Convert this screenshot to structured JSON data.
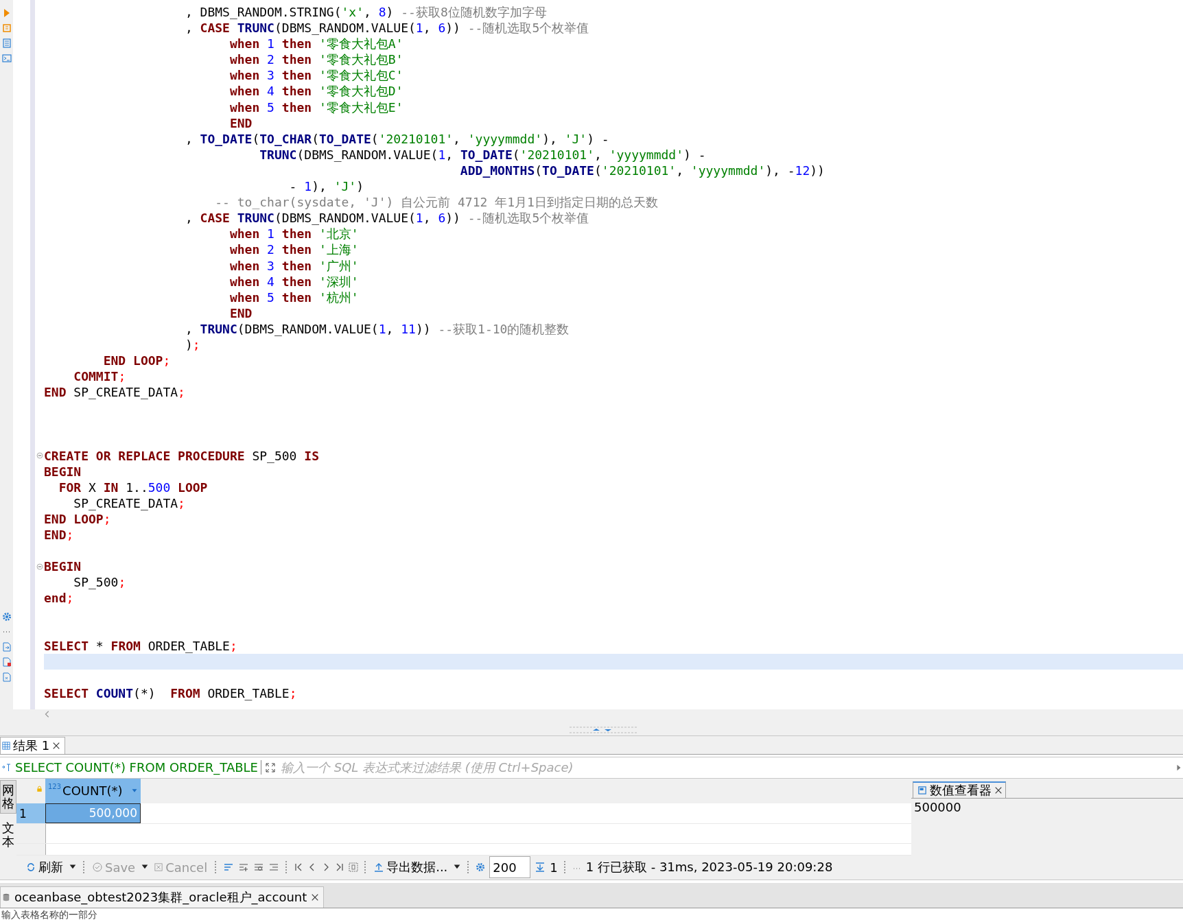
{
  "editor": {
    "lines": [
      {
        "tokens": [
          {
            "kind": "plain",
            "text": "                   , DBMS_RANDOM.STRING("
          },
          {
            "kind": "string",
            "text": "'x'"
          },
          {
            "kind": "plain",
            "text": ", "
          },
          {
            "kind": "number",
            "text": "8"
          },
          {
            "kind": "plain",
            "text": ") "
          },
          {
            "kind": "comment",
            "text": "--获取8位随机数字加字母"
          }
        ],
        "current": false,
        "fold": false
      },
      {
        "tokens": [
          {
            "kind": "plain",
            "text": "                   , "
          },
          {
            "kind": "keyword",
            "text": "CASE "
          },
          {
            "kind": "function",
            "text": "TRUNC"
          },
          {
            "kind": "plain",
            "text": "(DBMS_RANDOM.VALUE("
          },
          {
            "kind": "number",
            "text": "1"
          },
          {
            "kind": "plain",
            "text": ", "
          },
          {
            "kind": "number",
            "text": "6"
          },
          {
            "kind": "plain",
            "text": "))"
          },
          {
            "kind": "comment",
            "text": " --随机选取5个枚举值"
          }
        ],
        "current": false,
        "fold": false
      },
      {
        "tokens": [
          {
            "kind": "keyword",
            "text": "                         when "
          },
          {
            "kind": "number",
            "text": "1 "
          },
          {
            "kind": "keyword",
            "text": "then "
          },
          {
            "kind": "string",
            "text": "'零食大礼包A'"
          }
        ],
        "current": false,
        "fold": false
      },
      {
        "tokens": [
          {
            "kind": "keyword",
            "text": "                         when "
          },
          {
            "kind": "number",
            "text": "2 "
          },
          {
            "kind": "keyword",
            "text": "then "
          },
          {
            "kind": "string",
            "text": "'零食大礼包B'"
          }
        ],
        "current": false,
        "fold": false
      },
      {
        "tokens": [
          {
            "kind": "keyword",
            "text": "                         when "
          },
          {
            "kind": "number",
            "text": "3 "
          },
          {
            "kind": "keyword",
            "text": "then "
          },
          {
            "kind": "string",
            "text": "'零食大礼包C'"
          }
        ],
        "current": false,
        "fold": false
      },
      {
        "tokens": [
          {
            "kind": "keyword",
            "text": "                         when "
          },
          {
            "kind": "number",
            "text": "4 "
          },
          {
            "kind": "keyword",
            "text": "then "
          },
          {
            "kind": "string",
            "text": "'零食大礼包D'"
          }
        ],
        "current": false,
        "fold": false
      },
      {
        "tokens": [
          {
            "kind": "keyword",
            "text": "                         when "
          },
          {
            "kind": "number",
            "text": "5 "
          },
          {
            "kind": "keyword",
            "text": "then "
          },
          {
            "kind": "string",
            "text": "'零食大礼包E'"
          }
        ],
        "current": false,
        "fold": false
      },
      {
        "tokens": [
          {
            "kind": "keyword",
            "text": "                         END"
          }
        ],
        "current": false,
        "fold": false
      },
      {
        "tokens": [
          {
            "kind": "plain",
            "text": "                   , "
          },
          {
            "kind": "function",
            "text": "TO_DATE"
          },
          {
            "kind": "plain",
            "text": "("
          },
          {
            "kind": "function",
            "text": "TO_CHAR"
          },
          {
            "kind": "plain",
            "text": "("
          },
          {
            "kind": "function",
            "text": "TO_DATE"
          },
          {
            "kind": "plain",
            "text": "("
          },
          {
            "kind": "string",
            "text": "'20210101'"
          },
          {
            "kind": "plain",
            "text": ", "
          },
          {
            "kind": "string",
            "text": "'yyyymmdd'"
          },
          {
            "kind": "plain",
            "text": "), "
          },
          {
            "kind": "string",
            "text": "'J'"
          },
          {
            "kind": "plain",
            "text": ") -"
          }
        ],
        "current": false,
        "fold": false
      },
      {
        "tokens": [
          {
            "kind": "function",
            "text": "                             TRUNC"
          },
          {
            "kind": "plain",
            "text": "(DBMS_RANDOM.VALUE("
          },
          {
            "kind": "number",
            "text": "1"
          },
          {
            "kind": "plain",
            "text": ", "
          },
          {
            "kind": "function",
            "text": "TO_DATE"
          },
          {
            "kind": "plain",
            "text": "("
          },
          {
            "kind": "string",
            "text": "'20210101'"
          },
          {
            "kind": "plain",
            "text": ", "
          },
          {
            "kind": "string",
            "text": "'yyyymmdd'"
          },
          {
            "kind": "plain",
            "text": ") -"
          }
        ],
        "current": false,
        "fold": false
      },
      {
        "tokens": [
          {
            "kind": "function",
            "text": "                                                        ADD_MONTHS"
          },
          {
            "kind": "plain",
            "text": "("
          },
          {
            "kind": "function",
            "text": "TO_DATE"
          },
          {
            "kind": "plain",
            "text": "("
          },
          {
            "kind": "string",
            "text": "'20210101'"
          },
          {
            "kind": "plain",
            "text": ", "
          },
          {
            "kind": "string",
            "text": "'yyyymmdd'"
          },
          {
            "kind": "plain",
            "text": "), -"
          },
          {
            "kind": "number",
            "text": "12"
          },
          {
            "kind": "plain",
            "text": "))"
          }
        ],
        "current": false,
        "fold": false
      },
      {
        "tokens": [
          {
            "kind": "plain",
            "text": "                                 - "
          },
          {
            "kind": "number",
            "text": "1"
          },
          {
            "kind": "plain",
            "text": "), "
          },
          {
            "kind": "string",
            "text": "'J'"
          },
          {
            "kind": "plain",
            "text": ")"
          }
        ],
        "current": false,
        "fold": false
      },
      {
        "tokens": [
          {
            "kind": "comment",
            "text": "                       -- to_char(sysdate, 'J') 自公元前 4712 年1月1日到指定日期的总天数"
          }
        ],
        "current": false,
        "fold": false
      },
      {
        "tokens": [
          {
            "kind": "plain",
            "text": "                   , "
          },
          {
            "kind": "keyword",
            "text": "CASE "
          },
          {
            "kind": "function",
            "text": "TRUNC"
          },
          {
            "kind": "plain",
            "text": "(DBMS_RANDOM.VALUE("
          },
          {
            "kind": "number",
            "text": "1"
          },
          {
            "kind": "plain",
            "text": ", "
          },
          {
            "kind": "number",
            "text": "6"
          },
          {
            "kind": "plain",
            "text": "))"
          },
          {
            "kind": "comment",
            "text": " --随机选取5个枚举值"
          }
        ],
        "current": false,
        "fold": false
      },
      {
        "tokens": [
          {
            "kind": "keyword",
            "text": "                         when "
          },
          {
            "kind": "number",
            "text": "1 "
          },
          {
            "kind": "keyword",
            "text": "then "
          },
          {
            "kind": "string",
            "text": "'北京'"
          }
        ],
        "current": false,
        "fold": false
      },
      {
        "tokens": [
          {
            "kind": "keyword",
            "text": "                         when "
          },
          {
            "kind": "number",
            "text": "2 "
          },
          {
            "kind": "keyword",
            "text": "then "
          },
          {
            "kind": "string",
            "text": "'上海'"
          }
        ],
        "current": false,
        "fold": false
      },
      {
        "tokens": [
          {
            "kind": "keyword",
            "text": "                         when "
          },
          {
            "kind": "number",
            "text": "3 "
          },
          {
            "kind": "keyword",
            "text": "then "
          },
          {
            "kind": "string",
            "text": "'广州'"
          }
        ],
        "current": false,
        "fold": false
      },
      {
        "tokens": [
          {
            "kind": "keyword",
            "text": "                         when "
          },
          {
            "kind": "number",
            "text": "4 "
          },
          {
            "kind": "keyword",
            "text": "then "
          },
          {
            "kind": "string",
            "text": "'深圳'"
          }
        ],
        "current": false,
        "fold": false
      },
      {
        "tokens": [
          {
            "kind": "keyword",
            "text": "                         when "
          },
          {
            "kind": "number",
            "text": "5 "
          },
          {
            "kind": "keyword",
            "text": "then "
          },
          {
            "kind": "string",
            "text": "'杭州'"
          }
        ],
        "current": false,
        "fold": false
      },
      {
        "tokens": [
          {
            "kind": "keyword",
            "text": "                         END"
          }
        ],
        "current": false,
        "fold": false
      },
      {
        "tokens": [
          {
            "kind": "plain",
            "text": "                   , "
          },
          {
            "kind": "function",
            "text": "TRUNC"
          },
          {
            "kind": "plain",
            "text": "(DBMS_RANDOM.VALUE("
          },
          {
            "kind": "number",
            "text": "1"
          },
          {
            "kind": "plain",
            "text": ", "
          },
          {
            "kind": "number",
            "text": "11"
          },
          {
            "kind": "plain",
            "text": "))"
          },
          {
            "kind": "comment",
            "text": " --获取1-10的随机整数"
          }
        ],
        "current": false,
        "fold": false
      },
      {
        "tokens": [
          {
            "kind": "plain",
            "text": "                   )"
          },
          {
            "kind": "semicolon",
            "text": ";"
          }
        ],
        "current": false,
        "fold": false
      },
      {
        "tokens": [
          {
            "kind": "keyword",
            "text": "        END LOOP"
          },
          {
            "kind": "semicolon",
            "text": ";"
          }
        ],
        "current": false,
        "fold": false
      },
      {
        "tokens": [
          {
            "kind": "keyword",
            "text": "    COMMIT"
          },
          {
            "kind": "semicolon",
            "text": ";"
          }
        ],
        "current": false,
        "fold": false
      },
      {
        "tokens": [
          {
            "kind": "keyword",
            "text": "END "
          },
          {
            "kind": "plain",
            "text": "SP_CREATE_DATA"
          },
          {
            "kind": "semicolon",
            "text": ";"
          }
        ],
        "current": false,
        "fold": false
      },
      {
        "current": false,
        "fold": false
      },
      {
        "current": false,
        "fold": false
      },
      {
        "current": false,
        "fold": false
      },
      {
        "tokens": [
          {
            "kind": "keyword",
            "text": "CREATE OR REPLACE PROCEDURE "
          },
          {
            "kind": "plain",
            "text": "SP_500 "
          },
          {
            "kind": "keyword",
            "text": "IS"
          }
        ],
        "current": false,
        "fold": true
      },
      {
        "tokens": [
          {
            "kind": "keyword",
            "text": "BEGIN"
          }
        ],
        "current": false,
        "fold": false
      },
      {
        "tokens": [
          {
            "kind": "keyword",
            "text": "  FOR "
          },
          {
            "kind": "plain",
            "text": "X "
          },
          {
            "kind": "keyword",
            "text": "IN "
          },
          {
            "kind": "plain",
            "text": "1.."
          },
          {
            "kind": "number",
            "text": "500 "
          },
          {
            "kind": "keyword",
            "text": "LOOP"
          }
        ],
        "current": false,
        "fold": false
      },
      {
        "tokens": [
          {
            "kind": "plain",
            "text": "    SP_CREATE_DATA"
          },
          {
            "kind": "semicolon",
            "text": ";"
          }
        ],
        "current": false,
        "fold": false
      },
      {
        "tokens": [
          {
            "kind": "keyword",
            "text": "END LOOP"
          },
          {
            "kind": "semicolon",
            "text": ";"
          }
        ],
        "current": false,
        "fold": false
      },
      {
        "tokens": [
          {
            "kind": "keyword",
            "text": "END"
          },
          {
            "kind": "semicolon",
            "text": ";"
          }
        ],
        "current": false,
        "fold": false
      },
      {
        "current": false,
        "fold": false
      },
      {
        "tokens": [
          {
            "kind": "keyword",
            "text": "BEGIN"
          }
        ],
        "current": false,
        "fold": true
      },
      {
        "tokens": [
          {
            "kind": "plain",
            "text": "    SP_500"
          },
          {
            "kind": "semicolon",
            "text": ";"
          }
        ],
        "current": false,
        "fold": false
      },
      {
        "tokens": [
          {
            "kind": "keyword",
            "text": "end"
          },
          {
            "kind": "semicolon",
            "text": ";"
          }
        ],
        "current": false,
        "fold": false
      },
      {
        "current": false,
        "fold": false
      },
      {
        "current": false,
        "fold": false
      },
      {
        "tokens": [
          {
            "kind": "keyword",
            "text": "SELECT "
          },
          {
            "kind": "plain",
            "text": "* "
          },
          {
            "kind": "keyword",
            "text": "FROM "
          },
          {
            "kind": "plain",
            "text": "ORDER_TABLE"
          },
          {
            "kind": "semicolon",
            "text": ";"
          }
        ],
        "current": false,
        "fold": false
      },
      {
        "current": true,
        "fold": false
      },
      {
        "current": false,
        "fold": false
      },
      {
        "tokens": [
          {
            "kind": "keyword",
            "text": "SELECT "
          },
          {
            "kind": "function",
            "text": "COUNT"
          },
          {
            "kind": "plain",
            "text": "(*)  "
          },
          {
            "kind": "keyword",
            "text": "FROM "
          },
          {
            "kind": "plain",
            "text": "ORDER_TABLE"
          },
          {
            "kind": "semicolon",
            "text": ";"
          }
        ],
        "current": false,
        "fold": false
      }
    ]
  },
  "results": {
    "tabs": [
      {
        "label": "结果 1",
        "selected": true
      }
    ],
    "query": "SELECT COUNT(*) FROM ORDER_TABLE",
    "filter": {
      "placeholder": "输入一个 SQL 表达式来过滤结果 (使用 Ctrl+Space)"
    },
    "view_modes": [
      {
        "label": "网格",
        "selected": true
      },
      {
        "label": "文本",
        "selected": false
      }
    ],
    "columns": [
      {
        "type_label": "123",
        "name": "COUNT(*)",
        "selected": true
      }
    ],
    "rows": [
      {
        "number": "1",
        "cells": [
          "500,000"
        ],
        "selected": true
      }
    ],
    "value_viewer": {
      "title": "数值查看器",
      "value": "500000"
    },
    "toolbar": {
      "refresh": "刷新",
      "save": {
        "label": "Save",
        "disabled": true
      },
      "cancel": {
        "label": "Cancel",
        "disabled": true
      },
      "export": "导出数据...",
      "fetch_size": "200",
      "fetch_count": "1"
    },
    "status": "1 行已获取 - 31ms, 2023-05-19 20:09:28"
  },
  "connection_tab": {
    "label": "oceanbase_obtest2023集群_oracle租户_account"
  },
  "navigator_filter": {
    "placeholder": "输入表格名称的一部分"
  }
}
